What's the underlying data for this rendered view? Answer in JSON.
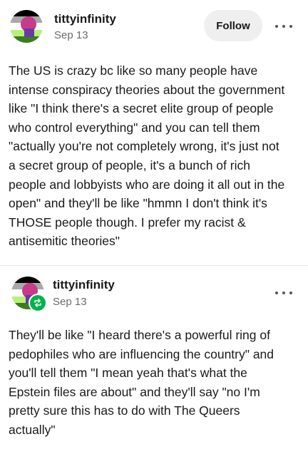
{
  "post1": {
    "username": "tittyinfinity",
    "date": "Sep 13",
    "follow_label": "Follow",
    "text": "The US is crazy bc like so many people have\nintense conspiracy theories about the government\nlike \"I think there's a secret elite group of people\nwho control everything\" and you can tell them\n\"actually you're not completely wrong, it's just not\na secret group of people, it's a bunch of rich\npeople and lobbyists who are doing it all out in the\nopen\" and they'll be like \"hmmn I don't think it's\nTHOSE people though. I prefer my racist &\nantisemitic theories\""
  },
  "post2": {
    "username": "tittyinfinity",
    "date": "Sep 13",
    "text": "They'll be like \"I heard there's a powerful ring of\npedophiles who are influencing the country\" and\nyou'll tell them \"I mean yeah that's what the\nEpstein files are about\" and they'll say \"no I'm\npretty sure this has to do with The Queers\nactually\""
  },
  "icons": {
    "more": "more-options-icon",
    "reblog": "reblog-icon"
  },
  "colors": {
    "reblog_badge": "#00b34d",
    "follow_bg": "#efefef",
    "date": "#6b6b6b"
  }
}
